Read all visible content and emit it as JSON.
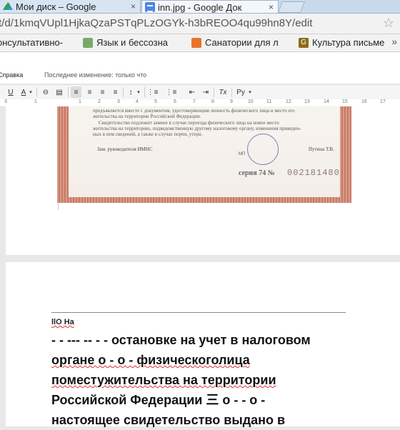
{
  "browser": {
    "tabs": [
      {
        "title": "Мои диск – Google",
        "close": "×",
        "icon": "google-drive-icon"
      },
      {
        "title": "inn.jpg - Google Док",
        "close": "×",
        "icon": "google-docs-icon"
      }
    ],
    "url_main": "t/d/1kmqVUpl1HjkaQzaPSTqPLzOGYk-h3bREOO4qu99hn8Y/edit",
    "bookmarks": [
      {
        "label": "онсультативно-",
        "icon": "bookmark-icon"
      },
      {
        "label": "Язык и бессозна",
        "icon": "page-icon"
      },
      {
        "label": "Санатории для л",
        "icon": "flame-icon"
      },
      {
        "label": "Культура письме",
        "icon": "g-logo-icon"
      }
    ],
    "bookmarks_more": "»"
  },
  "docs": {
    "menu_help": "Справка",
    "last_edit": "Последнее изменение: только что",
    "toolbar": {
      "underline": "U",
      "text_color": "A",
      "link": "⊖",
      "comment": "▤",
      "align_left": "≡",
      "align_center": "≡",
      "align_right": "≡",
      "justify": "≡",
      "line_spacing": "↕",
      "numbered_list": "⋮≡",
      "bulleted_list": "⋮≡",
      "decrease_indent": "⇤",
      "increase_indent": "⇥",
      "clear_format": "Tx",
      "input_tools": "Ру"
    },
    "ruler": [
      "3",
      "1",
      "1",
      "2",
      "3",
      "4",
      "5",
      "6",
      "7",
      "8",
      "9",
      "10",
      "11",
      "12",
      "13",
      "14",
      "15",
      "16",
      "17"
    ]
  },
  "certificate": {
    "lines": [
      "предъявляется вместе с документом, удостоверяющим личность физического лица и место его",
      "жительства на территории Российской Федерации.",
      "Свидетельство подлежит замене в случае переезда физического лица на новое место",
      "жительства на территорию, подведомственную другому налоговому органу, изменения приведен-",
      "ных в нем сведений, а также в случае порчи, утери."
    ],
    "signer_title": "Зам. руководителя ИМНС",
    "signer_name": "Путина Т.В.",
    "stamp_caption": "МП",
    "series_label": "серия 74  №",
    "serial_number": "002181480"
  },
  "page2": {
    "small_heading": "llO На",
    "lines": [
      "- - --- -- - - остановке на учет в налоговом",
      "органе о - о - физическоголица",
      "поместужительства на территории",
      "Российской Федерации 三 о - - о -",
      "настоящее свидетельство выдано в"
    ]
  }
}
